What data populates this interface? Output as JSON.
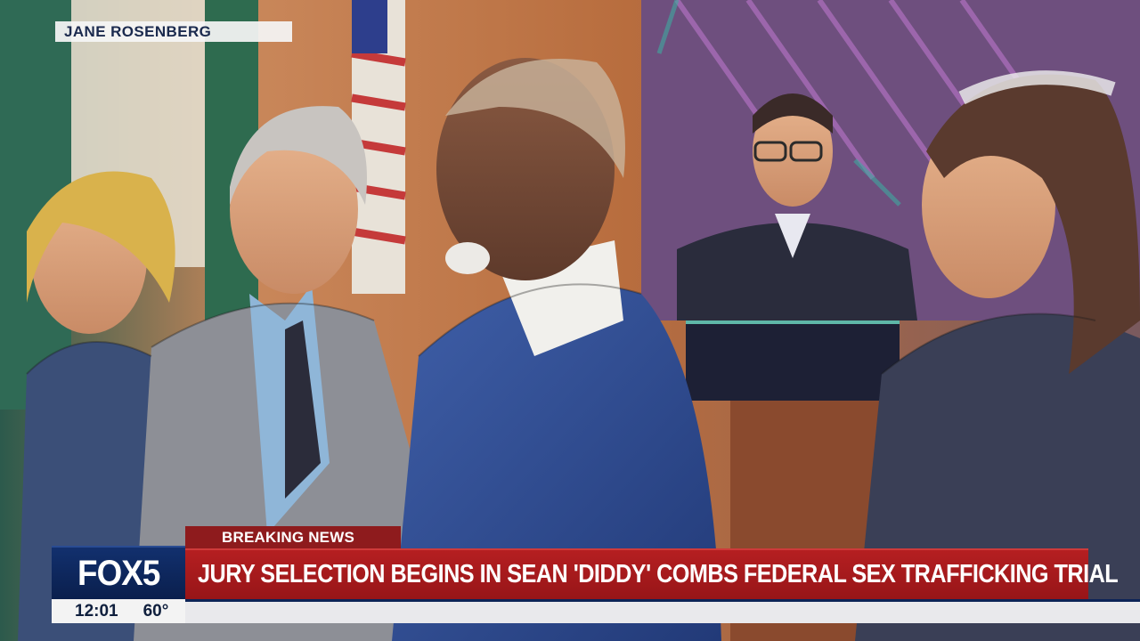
{
  "credit": "JANE ROSENBERG",
  "logo": "FOX5",
  "time": "12:01",
  "temperature": "60°",
  "breaking_label": "BREAKING NEWS",
  "headline": "JURY SELECTION BEGINS IN SEAN 'DIDDY' COMBS FEDERAL SEX TRAFFICKING TRIAL",
  "colors": {
    "brand_navy": "#0a1f4d",
    "breaking_red": "#8e1b1d",
    "headline_red": "#b51f21"
  }
}
